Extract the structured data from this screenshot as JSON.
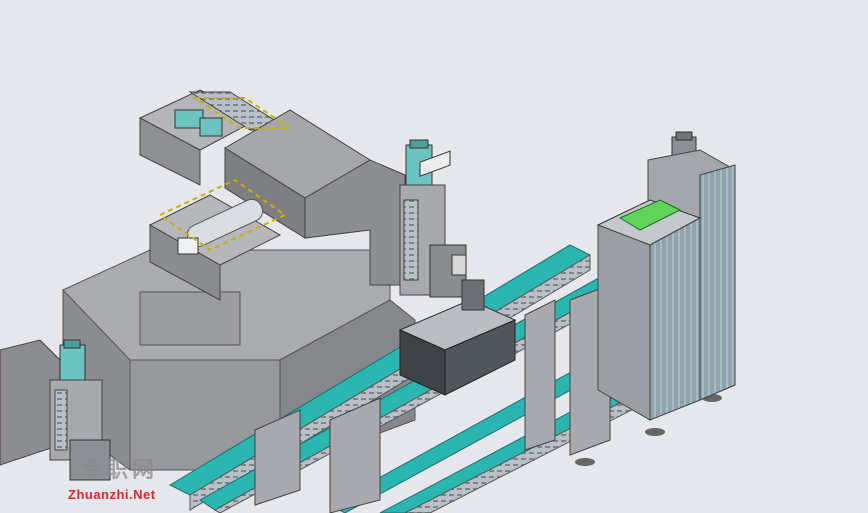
{
  "watermark": {
    "chinese_text": "专职网",
    "english_text": "Zhuanzhi.Net",
    "english_color": "#e0262a"
  },
  "colors": {
    "background": "#e6e7ec",
    "machine_gray": "#9c9ea2",
    "belt_teal": "#2ab5b1",
    "rail_aluminum": "#b9bfc6",
    "motor_teal": "#6cc3bf",
    "lcd_green": "#5fd35a",
    "frame_gray": "#8c8f95"
  }
}
